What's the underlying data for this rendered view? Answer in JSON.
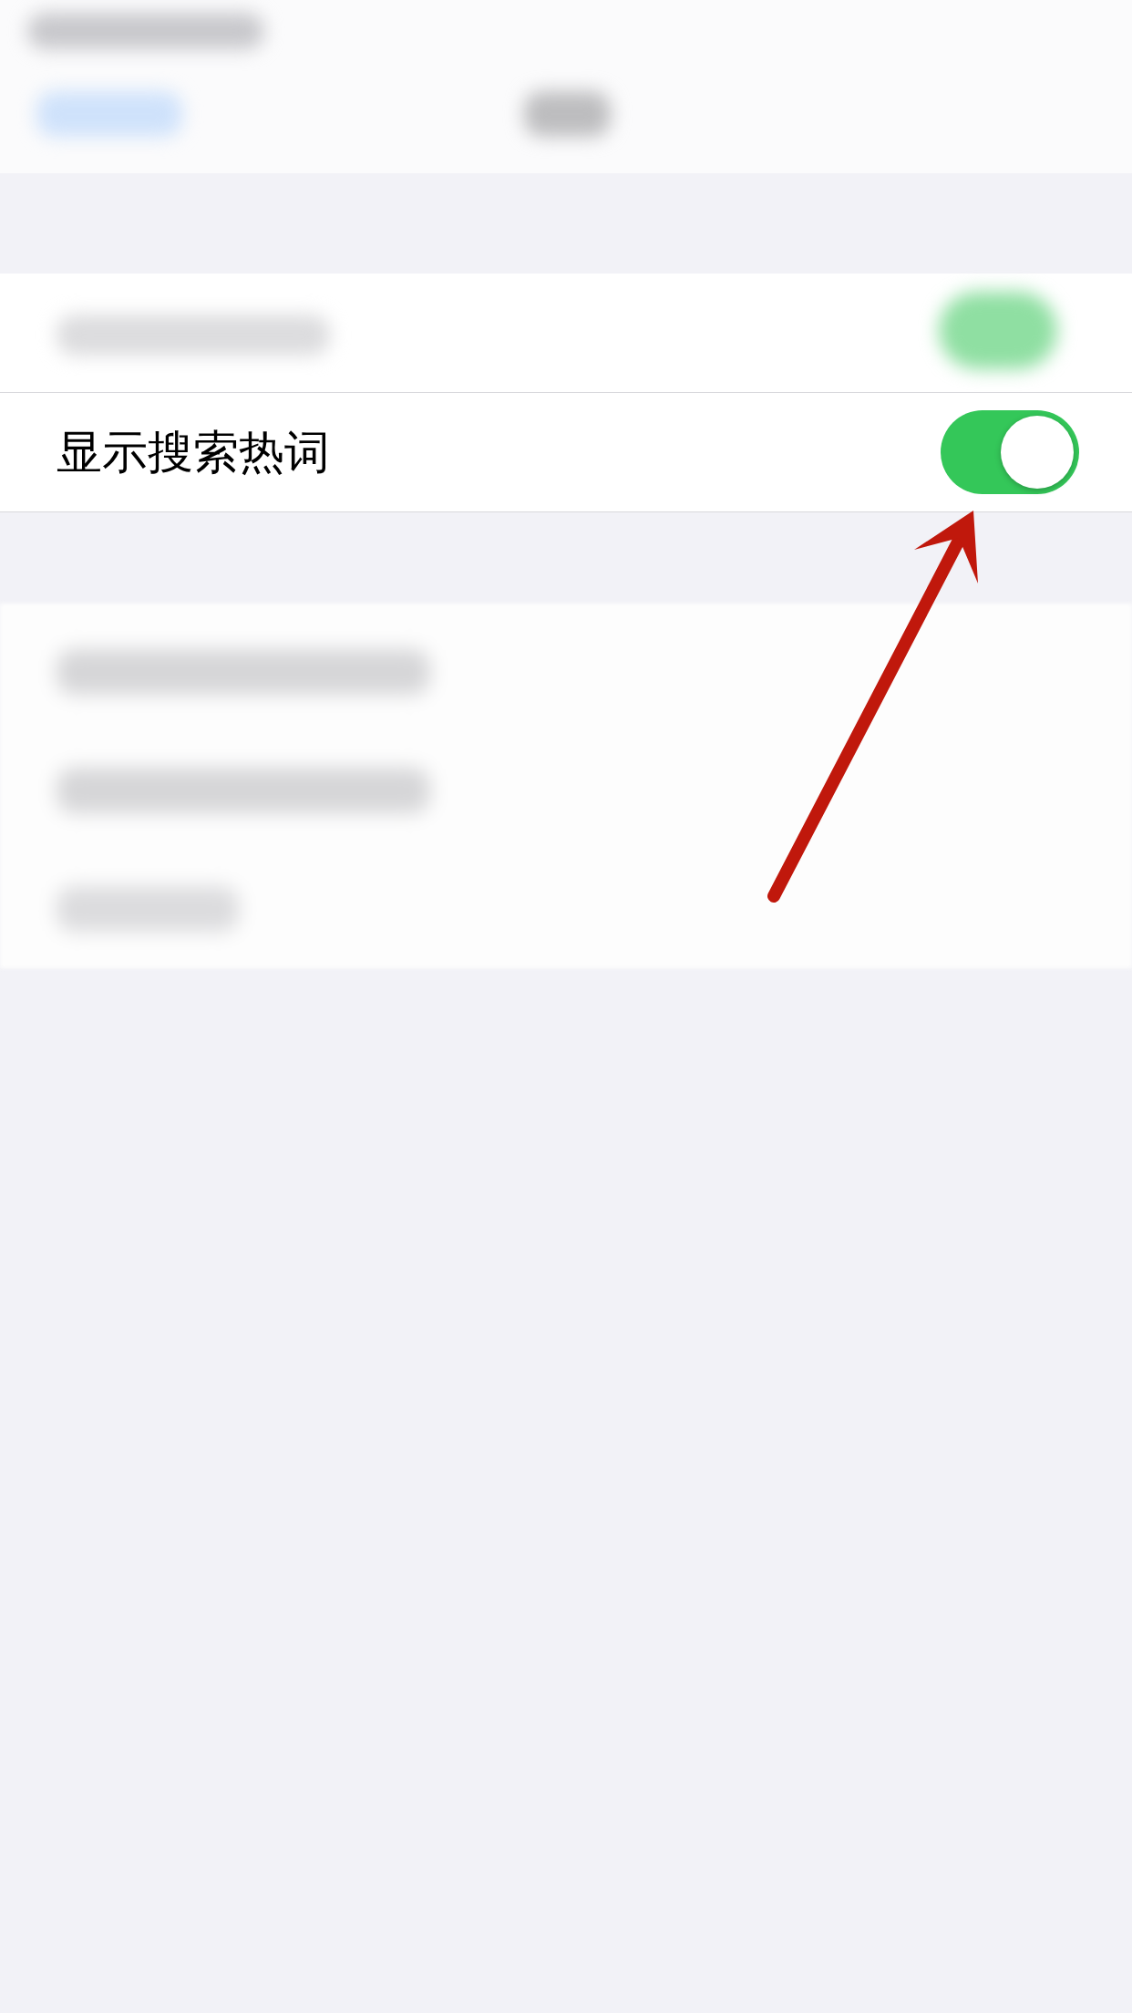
{
  "setting": {
    "label": "显示搜索热词",
    "on": true
  },
  "annotation": {
    "kind": "arrow"
  }
}
